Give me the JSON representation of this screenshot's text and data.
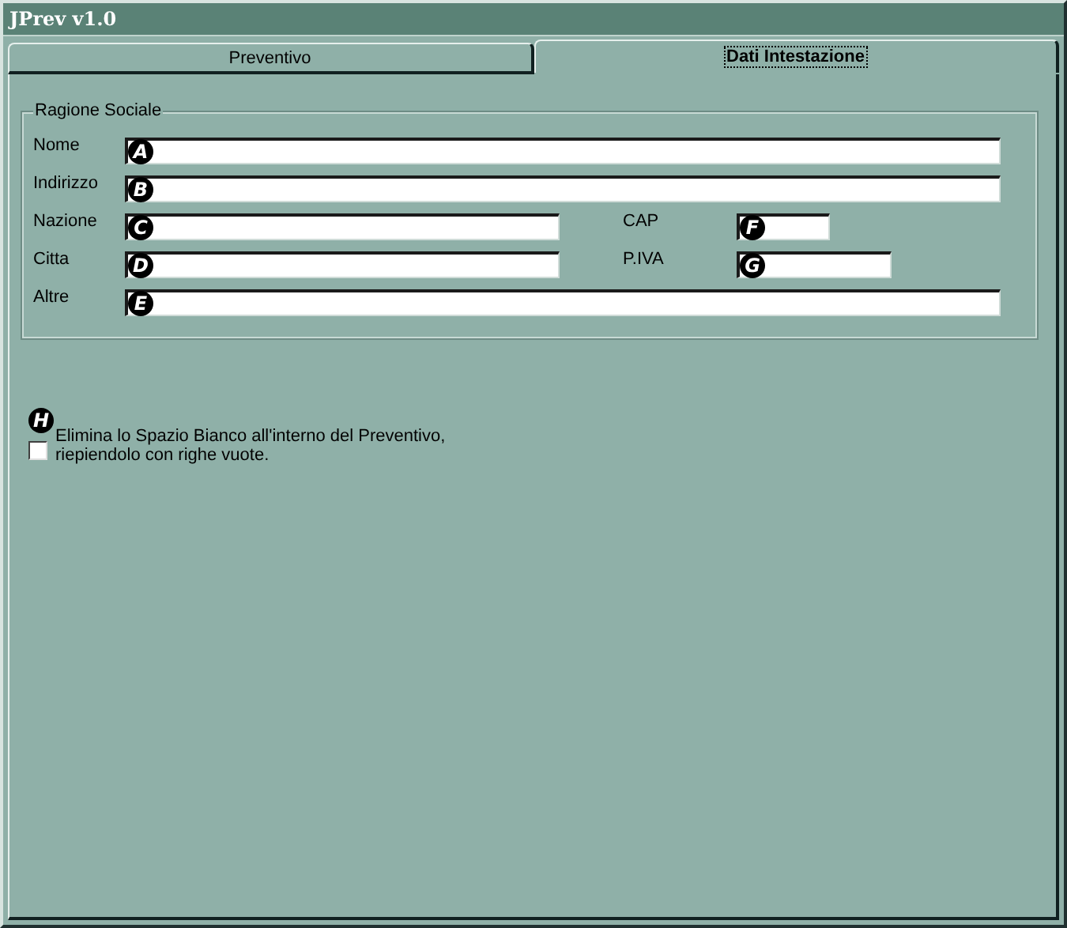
{
  "window": {
    "title": "JPrev v1.0"
  },
  "tabs": [
    {
      "label": "Preventivo",
      "selected": false
    },
    {
      "label": "Dati Intestazione",
      "selected": true
    }
  ],
  "group": {
    "title": "Ragione Sociale",
    "rows": [
      {
        "fields": [
          {
            "label": "Nome",
            "marker": "A",
            "kind": "full"
          }
        ]
      },
      {
        "fields": [
          {
            "label": "Indirizzo",
            "marker": "B",
            "kind": "full"
          }
        ]
      },
      {
        "fields": [
          {
            "label": "Nazione",
            "marker": "C",
            "kind": "half"
          },
          {
            "label": "CAP",
            "marker": "F",
            "kind": "small"
          }
        ]
      },
      {
        "fields": [
          {
            "label": "Citta",
            "marker": "D",
            "kind": "half"
          },
          {
            "label": "P.IVA",
            "marker": "G",
            "kind": "medium"
          }
        ]
      },
      {
        "fields": [
          {
            "label": "Altre",
            "marker": "E",
            "kind": "full"
          }
        ]
      }
    ]
  },
  "option": {
    "marker": "H",
    "checked": false,
    "label": "Elimina lo Spazio Bianco all'interno del Preventivo, riepiendolo con righe vuote."
  }
}
